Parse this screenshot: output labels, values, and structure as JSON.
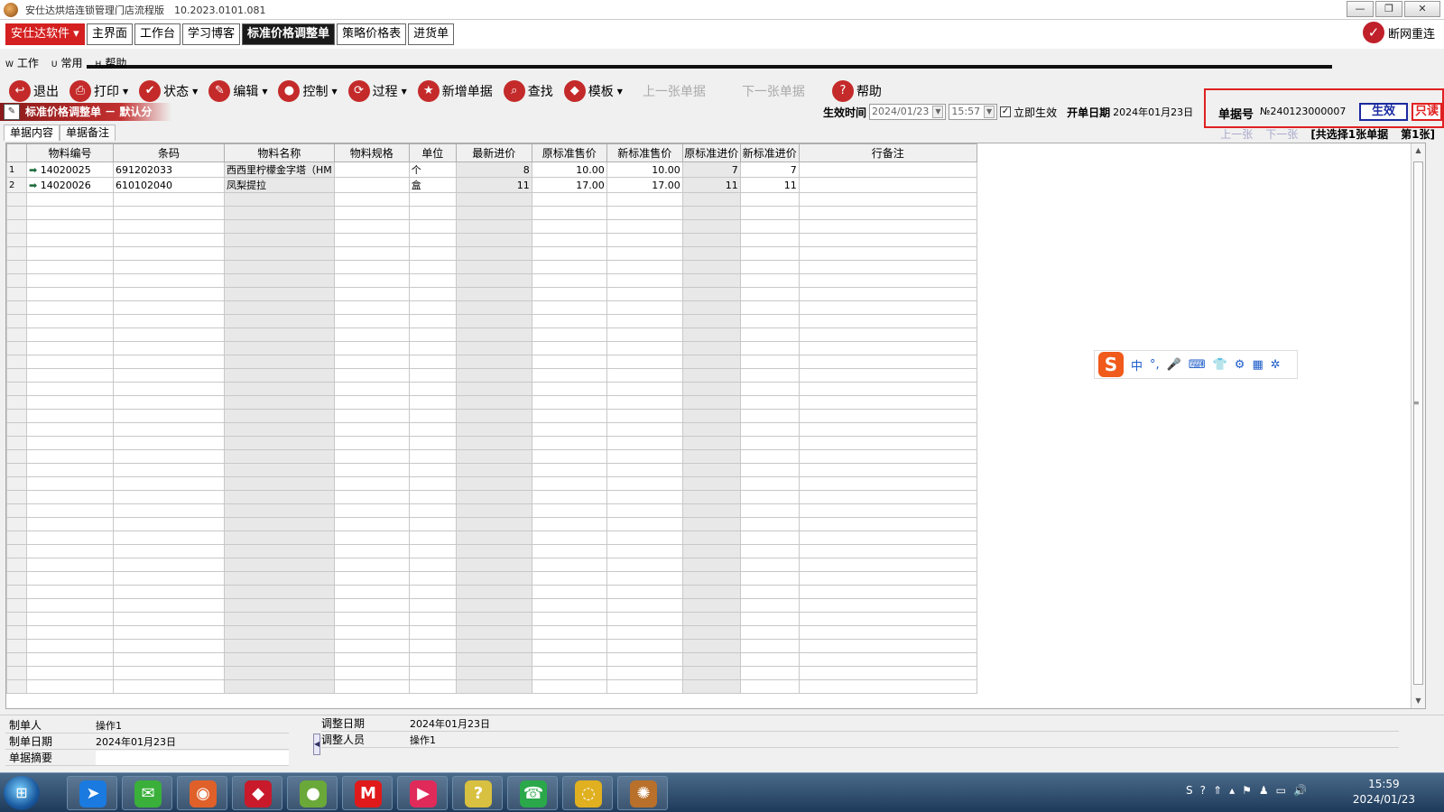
{
  "window": {
    "title": "安仕达烘焙连锁管理门店流程版　10.2023.0101.081",
    "minimize": "—",
    "restore": "❐",
    "close": "✕"
  },
  "brand_button": "安仕达软件 ▾",
  "main_tabs": [
    {
      "label": "主界面",
      "active": false
    },
    {
      "label": "工作台",
      "active": false
    },
    {
      "label": "学习博客",
      "active": false
    },
    {
      "label": "标准价格调整单",
      "active": true
    },
    {
      "label": "策略价格表",
      "active": false
    },
    {
      "label": "进货单",
      "active": false
    }
  ],
  "reconnect_label": "断网重连",
  "menu": [
    {
      "mnemonic": "W",
      "label": "工作"
    },
    {
      "mnemonic": "U",
      "label": "常用"
    },
    {
      "mnemonic": "H",
      "label": "帮助"
    }
  ],
  "toolbar": [
    {
      "label": "退出",
      "icon": "↩",
      "dropdown": false,
      "disabled": false
    },
    {
      "label": "打印",
      "icon": "⎙",
      "dropdown": true,
      "disabled": false
    },
    {
      "label": "状态",
      "icon": "✔",
      "dropdown": true,
      "disabled": false
    },
    {
      "label": "编辑",
      "icon": "✎",
      "dropdown": true,
      "disabled": false
    },
    {
      "label": "控制",
      "icon": "●",
      "dropdown": true,
      "disabled": false
    },
    {
      "label": "过程",
      "icon": "⟳",
      "dropdown": true,
      "disabled": false
    },
    {
      "label": "新增单据",
      "icon": "★",
      "dropdown": false,
      "disabled": false
    },
    {
      "label": "查找",
      "icon": "⌕",
      "dropdown": false,
      "disabled": false
    },
    {
      "label": "模板",
      "icon": "◆",
      "dropdown": true,
      "disabled": false
    },
    {
      "label": "上一张单据",
      "icon": "",
      "dropdown": false,
      "disabled": true
    },
    {
      "label": "下一张单据",
      "icon": "",
      "dropdown": false,
      "disabled": true
    },
    {
      "label": "帮助",
      "icon": "?",
      "dropdown": false,
      "disabled": false
    }
  ],
  "doc_title": "标准价格调整单 － 默认分",
  "effect": {
    "label": "生效时间",
    "date": "2024/01/23",
    "time": "15:57",
    "immediate_label": "立即生效",
    "immediate_checked": true,
    "open_date_label": "开单日期",
    "open_date": "2024年01月23日"
  },
  "doc_no": {
    "label": "单据号",
    "value": "№240123000007",
    "status_effect": "生效",
    "status_readonly": "只读"
  },
  "sub_tabs": [
    {
      "label": "单据内容",
      "active": true
    },
    {
      "label": "单据备注",
      "active": false
    }
  ],
  "selection_info": {
    "prev": "上一张",
    "next": "下一张",
    "selected": "[共选择1张单据",
    "page": "第1张]"
  },
  "grid": {
    "columns": [
      "物料编号",
      "条码",
      "物料名称",
      "物料规格",
      "单位",
      "最新进价",
      "原标准售价",
      "新标准售价",
      "原标准进价",
      "新标准进价",
      "行备注"
    ],
    "rows": [
      [
        "1",
        "14020025",
        "691202033",
        "西西里柠檬金字塔（HM",
        "",
        "个",
        "8",
        "10.00",
        "10.00",
        "7",
        "7",
        ""
      ],
      [
        "2",
        "14020026",
        "610102040",
        "凤梨提拉",
        "",
        "盒",
        "11",
        "17.00",
        "17.00",
        "11",
        "11",
        ""
      ]
    ]
  },
  "ime": {
    "logo": "S",
    "items": [
      "中",
      "°,",
      "🎤",
      "⌨",
      "👕",
      "⚙",
      "▦",
      "✲"
    ]
  },
  "footer": {
    "left": [
      {
        "label": "制单人",
        "value": "操作1"
      },
      {
        "label": "制单日期",
        "value": "2024年01月23日"
      },
      {
        "label": "单据摘要",
        "value": ""
      }
    ],
    "right": [
      {
        "label": "调整日期",
        "value": "2024年01月23日"
      },
      {
        "label": "调整人员",
        "value": "操作1"
      }
    ]
  },
  "taskbar": {
    "apps": [
      {
        "name": "feishu",
        "glyph": "➤",
        "color": "#1a7ae0"
      },
      {
        "name": "wechat",
        "glyph": "✉",
        "color": "#3ab03a"
      },
      {
        "name": "firefox",
        "glyph": "◉",
        "color": "#e0602a"
      },
      {
        "name": "app-red-blue",
        "glyph": "◆",
        "color": "#c81a2a"
      },
      {
        "name": "apple-logo",
        "glyph": "●",
        "color": "#6aa83a"
      },
      {
        "name": "metro-m",
        "glyph": "M",
        "color": "#e01a1a"
      },
      {
        "name": "kuaishou",
        "glyph": "▶",
        "color": "#e02a5a"
      },
      {
        "name": "help-doc",
        "glyph": "?",
        "color": "#d8c040"
      },
      {
        "name": "qq-call",
        "glyph": "☎",
        "color": "#2aa84a"
      },
      {
        "name": "chat-bubble",
        "glyph": "◌",
        "color": "#e0b020"
      },
      {
        "name": "bakery-app",
        "glyph": "✺",
        "color": "#b8702a"
      }
    ],
    "tray": [
      "S",
      "?",
      "⇑",
      "▴",
      "⚑",
      "♟",
      "▭",
      "🔊"
    ],
    "time": "15:59",
    "date": "2024/01/23"
  }
}
